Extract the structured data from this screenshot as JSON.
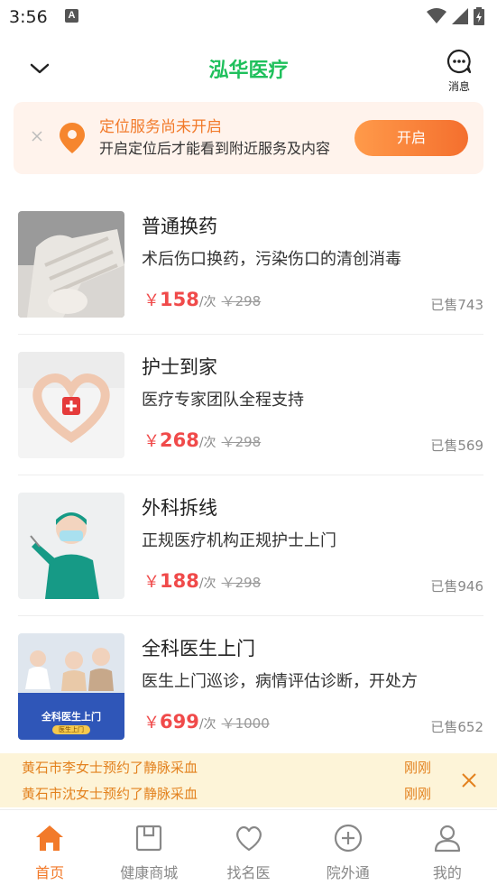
{
  "status_bar": {
    "time": "3:56",
    "indicator": "A"
  },
  "nav": {
    "title": "泓华医疗",
    "message_label": "消息",
    "title_color": "#1fc05c"
  },
  "location_banner": {
    "title": "定位服务尚未开启",
    "subtitle": "开启定位后才能看到附近服务及内容",
    "button_label": "开启"
  },
  "services": [
    {
      "title": "普通换药",
      "desc": "术后伤口换药，污染伤口的清创消毒",
      "price_symbol": "￥",
      "price": "158",
      "unit": "/次",
      "old_price": "￥298",
      "sold": "已售743",
      "image_icon": "bandage-photo"
    },
    {
      "title": "护士到家",
      "desc": "医疗专家团队全程支持",
      "price_symbol": "￥",
      "price": "268",
      "unit": "/次",
      "old_price": "￥298",
      "sold": "已售569",
      "image_icon": "heart-hands-photo"
    },
    {
      "title": "外科拆线",
      "desc": "正规医疗机构正规护士上门",
      "price_symbol": "￥",
      "price": "188",
      "unit": "/次",
      "old_price": "￥298",
      "sold": "已售946",
      "image_icon": "nurse-photo"
    },
    {
      "title": "全科医生上门",
      "desc": "医生上门巡诊，病情评估诊断，开处方",
      "price_symbol": "￥",
      "price": "699",
      "unit": "/次",
      "old_price": "￥1000",
      "sold": "已售652",
      "image_icon": "doctor-visit-photo",
      "image_caption": "全科医生上门",
      "image_badge": "医生上门"
    }
  ],
  "notices": [
    {
      "text": "黄石市李女士预约了静脉采血",
      "time": "刚刚"
    },
    {
      "text": "黄石市沈女士预约了静脉采血",
      "time": "刚刚"
    }
  ],
  "tabs": [
    {
      "label": "首页",
      "icon": "home-icon",
      "active": true
    },
    {
      "label": "健康商城",
      "icon": "shop-icon",
      "active": false
    },
    {
      "label": "找名医",
      "icon": "heart-icon",
      "active": false
    },
    {
      "label": "院外通",
      "icon": "plus-circle-icon",
      "active": false
    },
    {
      "label": "我的",
      "icon": "user-icon",
      "active": false
    }
  ],
  "colors": {
    "accent": "#f27a2a",
    "price": "#f04a4a",
    "brand": "#1fc05c"
  }
}
